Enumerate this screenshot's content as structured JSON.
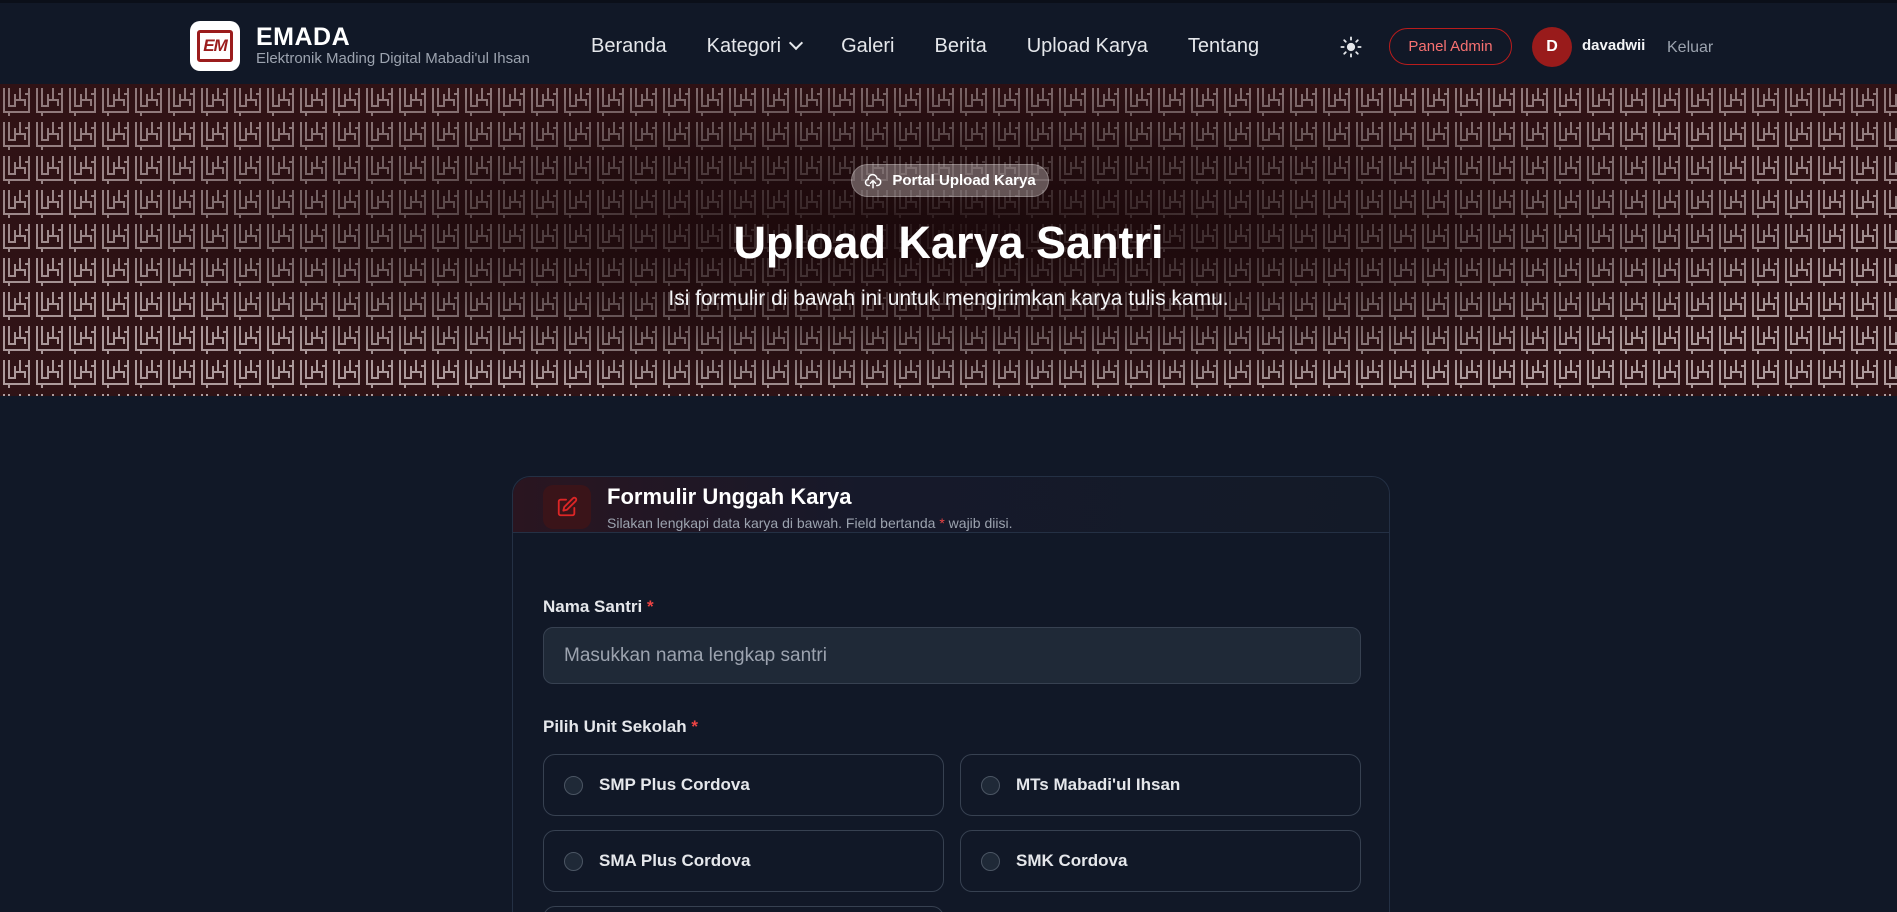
{
  "brand": {
    "logo_text": "EM",
    "title": "EMADA",
    "subtitle": "Elektronik Mading Digital Mabadi'ul Ihsan"
  },
  "nav": {
    "items": [
      {
        "label": "Beranda"
      },
      {
        "label": "Kategori",
        "has_dropdown": true
      },
      {
        "label": "Galeri"
      },
      {
        "label": "Berita"
      },
      {
        "label": "Upload Karya"
      },
      {
        "label": "Tentang"
      }
    ],
    "theme_icon": "sun-icon",
    "admin_label": "Panel Admin",
    "avatar_initial": "D",
    "username": "davadwii",
    "logout_label": "Keluar"
  },
  "hero": {
    "badge": "Portal Upload Karya",
    "badge_icon": "cloud-upload-icon",
    "title": "Upload Karya Santri",
    "subtitle": "Isi formulir di bawah ini untuk mengirimkan karya tulis kamu."
  },
  "form": {
    "header_icon": "edit-icon",
    "title": "Formulir Unggah Karya",
    "subtitle_before": "Silakan lengkapi data karya di bawah. Field bertanda ",
    "subtitle_star": "*",
    "subtitle_after": " wajib diisi.",
    "name_label": "Nama Santri",
    "required_mark": "*",
    "name_placeholder": "Masukkan nama lengkap santri",
    "name_value": "",
    "unit_label": "Pilih Unit Sekolah",
    "units": [
      {
        "label": "SMP Plus Cordova"
      },
      {
        "label": "MTs Mabadi'ul Ihsan"
      },
      {
        "label": "SMA Plus Cordova"
      },
      {
        "label": "SMK Cordova"
      }
    ]
  },
  "colors": {
    "accent": "#b91c1c",
    "background": "#111827",
    "card_border": "#243044"
  }
}
